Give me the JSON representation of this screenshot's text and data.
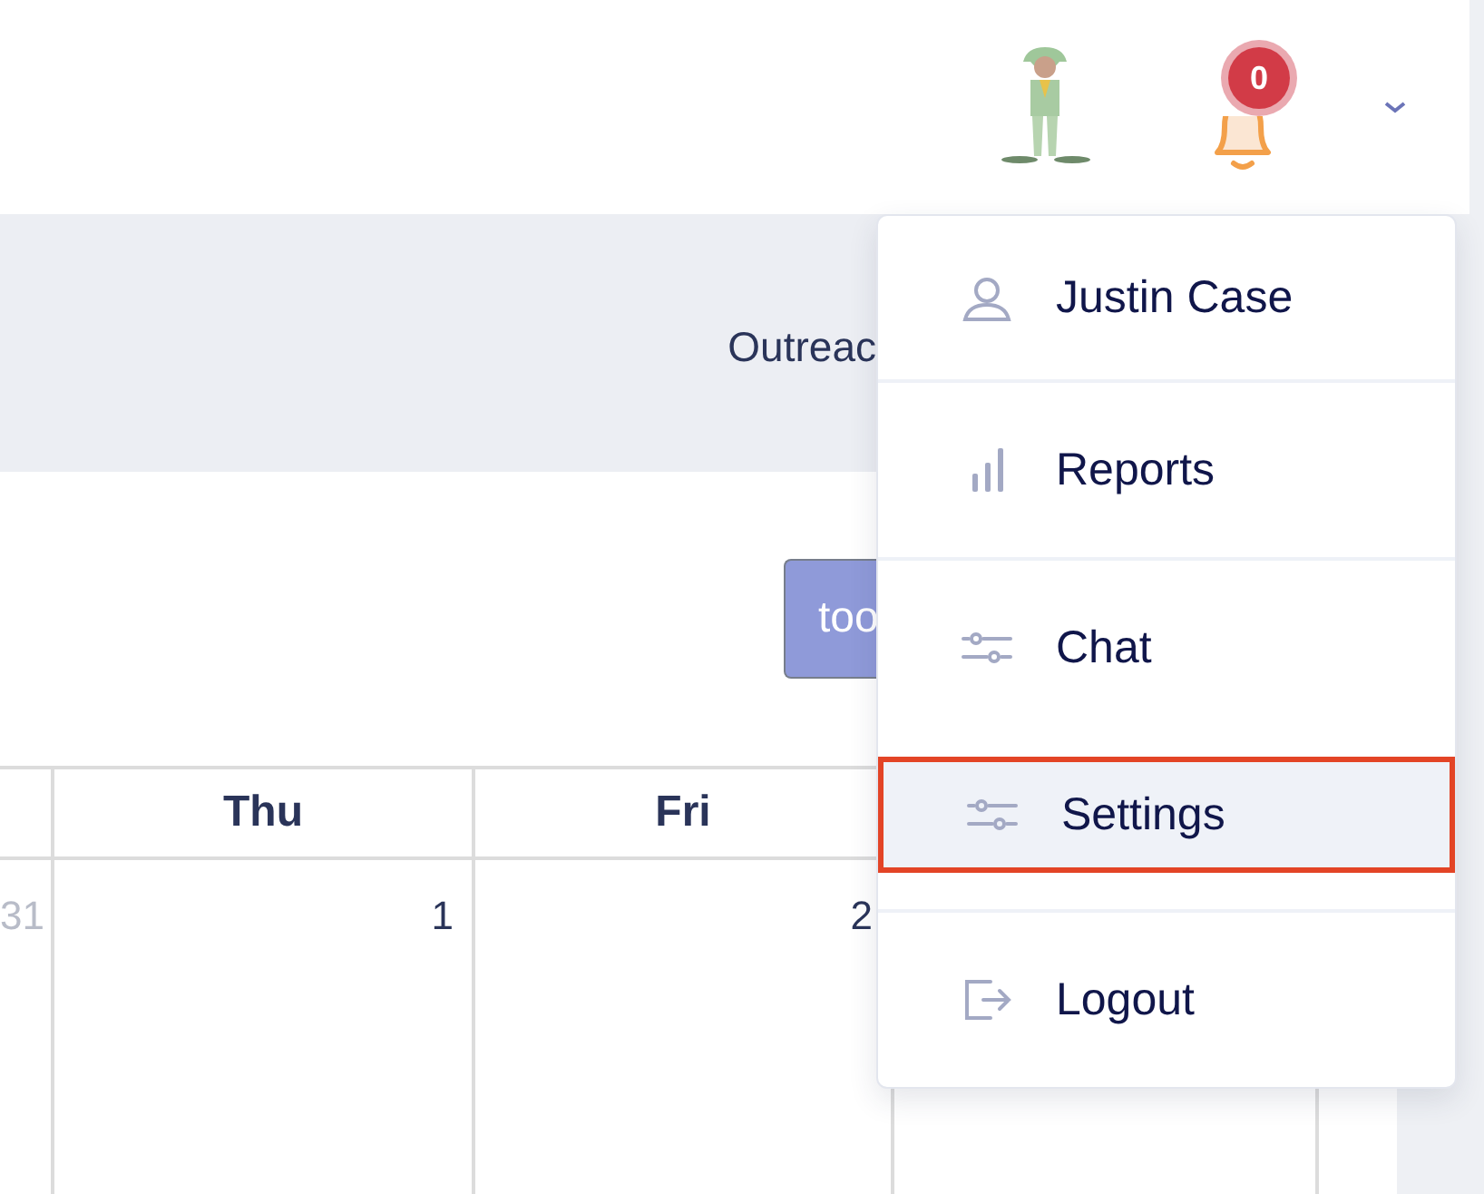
{
  "header": {
    "notifications": {
      "count": "0"
    }
  },
  "banner": {
    "title": "Outreac"
  },
  "toolbar": {
    "button": "too"
  },
  "calendar": {
    "columns": [
      {
        "label": "Thu"
      },
      {
        "label": "Fri"
      }
    ],
    "cells": [
      {
        "day": "31",
        "other_month": true
      },
      {
        "day": "1",
        "other_month": false
      },
      {
        "day": "2",
        "other_month": false
      }
    ]
  },
  "user_menu": {
    "items": [
      {
        "label": "Justin Case",
        "kind": "profile",
        "selected": false
      },
      {
        "label": "Reports",
        "kind": "reports",
        "selected": false
      },
      {
        "label": "Chat",
        "kind": "chat",
        "selected": false
      },
      {
        "label": "Settings",
        "kind": "settings",
        "selected": true
      },
      {
        "label": "Logout",
        "kind": "logout",
        "selected": false
      }
    ]
  }
}
